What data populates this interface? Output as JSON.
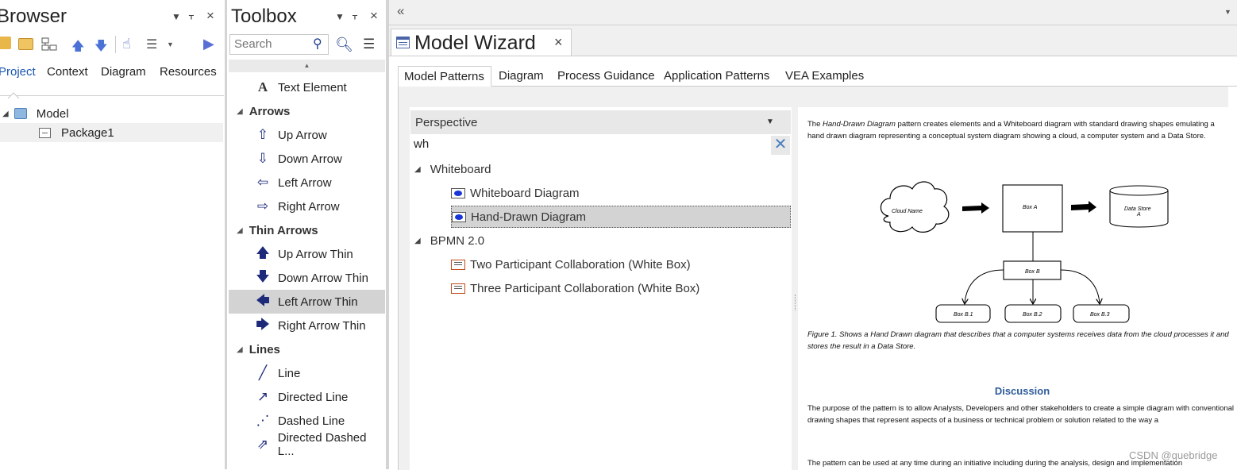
{
  "browser": {
    "title": "Browser",
    "tabs": [
      "Project",
      "Context",
      "Diagram",
      "Resources"
    ],
    "tree": [
      {
        "label": "Model",
        "icon": "model-root-icon"
      },
      {
        "label": "Package1",
        "icon": "package-icon"
      }
    ]
  },
  "toolbox": {
    "title": "Toolbox",
    "search_placeholder": "Search",
    "items": [
      {
        "type": "item",
        "label": "Text Element",
        "glyph": "A"
      },
      {
        "type": "cat",
        "label": "Arrows"
      },
      {
        "type": "item",
        "label": "Up Arrow",
        "glyph": "⇧"
      },
      {
        "type": "item",
        "label": "Down Arrow",
        "glyph": "⇩"
      },
      {
        "type": "item",
        "label": "Left Arrow",
        "glyph": "⇦"
      },
      {
        "type": "item",
        "label": "Right Arrow",
        "glyph": "⇨"
      },
      {
        "type": "cat",
        "label": "Thin Arrows"
      },
      {
        "type": "item",
        "label": "Up Arrow Thin",
        "glyph": "🡅"
      },
      {
        "type": "item",
        "label": "Down Arrow Thin",
        "glyph": "🡇"
      },
      {
        "type": "item",
        "label": "Left Arrow Thin",
        "glyph": "🡄",
        "selected": true
      },
      {
        "type": "item",
        "label": "Right Arrow Thin",
        "glyph": "🡆"
      },
      {
        "type": "cat",
        "label": "Lines"
      },
      {
        "type": "item",
        "label": "Line",
        "glyph": "╱"
      },
      {
        "type": "item",
        "label": "Directed Line",
        "glyph": "↗"
      },
      {
        "type": "item",
        "label": "Dashed Line",
        "glyph": "⋰"
      },
      {
        "type": "item",
        "label": "Directed Dashed L...",
        "glyph": "⇗"
      }
    ]
  },
  "wizard": {
    "tab_title": "Model Wizard",
    "tabs": [
      "Model Patterns",
      "Diagram",
      "Process Guidance",
      "Application Patterns",
      "VEA Examples"
    ],
    "perspective": "Perspective",
    "filter_value": "wh",
    "tree": [
      {
        "type": "group",
        "label": "Whiteboard"
      },
      {
        "type": "leaf",
        "label": "Whiteboard Diagram",
        "icon": "whiteboard-pattern-icon"
      },
      {
        "type": "leaf",
        "label": "Hand-Drawn Diagram",
        "icon": "whiteboard-pattern-icon",
        "selected": true
      },
      {
        "type": "group",
        "label": "BPMN 2.0"
      },
      {
        "type": "leaf",
        "label": "Two Participant Collaboration (White Box)",
        "icon": "bpmn-pattern-icon"
      },
      {
        "type": "leaf",
        "label": "Three Participant Collaboration (White Box)",
        "icon": "bpmn-pattern-icon"
      }
    ]
  },
  "doc": {
    "intro_pre": "The ",
    "intro_em": "Hand-Drawn Diagram",
    "intro_post": " pattern creates elements and a Whiteboard diagram with standard drawing shapes emulating a hand drawn diagram representing a conceptual system diagram showing a cloud, a computer system and a Data Store.",
    "diagram": {
      "cloud": "Cloud Name",
      "box_a": "Box A",
      "store_line1": "Data Store",
      "store_line2": "A",
      "box_b": "Box B",
      "box_b1": "Box B.1",
      "box_b2": "Box B.2",
      "box_b3": "Box B.3"
    },
    "caption": "Figure 1. Shows a Hand Drawn diagram that describes that a computer systems receives data from the cloud processes it and stores the result in a Data Store.",
    "heading": "Discussion",
    "para1": "The purpose of the pattern is to allow Analysts, Developers and other stakeholders to create a simple diagram with conventional drawing shapes that represent aspects of a business or technical problem or solution related to the way a",
    "para2": "The pattern can be used at any time during an initiative including during the analysis, design and implementation"
  },
  "watermark": "CSDN @quebridge",
  "colors": {
    "accent": "#1a56b0",
    "selection": "#d3d3d3",
    "heading": "#2e5b9a"
  }
}
